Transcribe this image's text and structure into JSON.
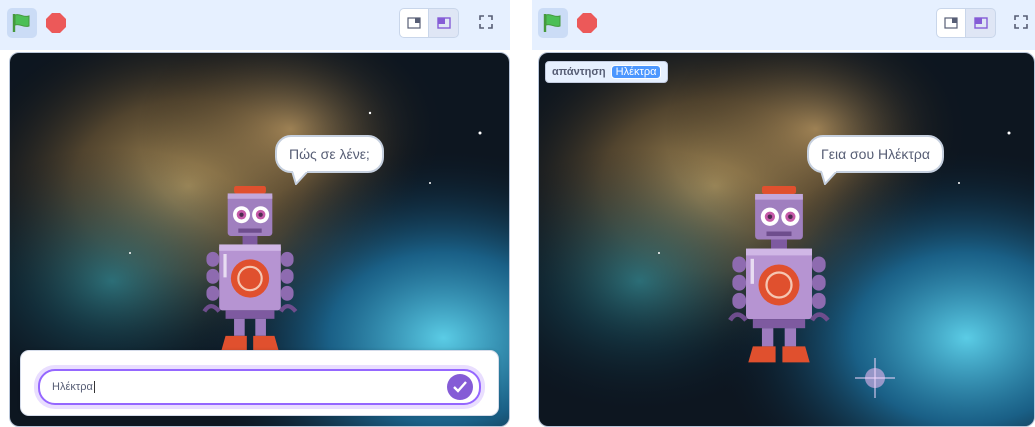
{
  "panels": [
    {
      "speech": "Πώς σε λένε;",
      "answer_input": "Ηλέκτρα"
    },
    {
      "speech": "Γεια σου Ηλέκτρα",
      "monitor": {
        "label": "απάντηση",
        "value": "Ηλέκτρα"
      }
    }
  ],
  "icons": {
    "green_flag": "green-flag-icon",
    "stop": "stop-icon",
    "small_stage": "small-stage-icon",
    "large_stage": "large-stage-icon",
    "fullscreen": "fullscreen-icon",
    "submit": "check-icon"
  },
  "colors": {
    "toolbar": "#e6f0ff",
    "accent": "#855cd6",
    "flag": "#4cbf56",
    "stop": "#ec5959",
    "monitor_value": "#4c97ff"
  }
}
